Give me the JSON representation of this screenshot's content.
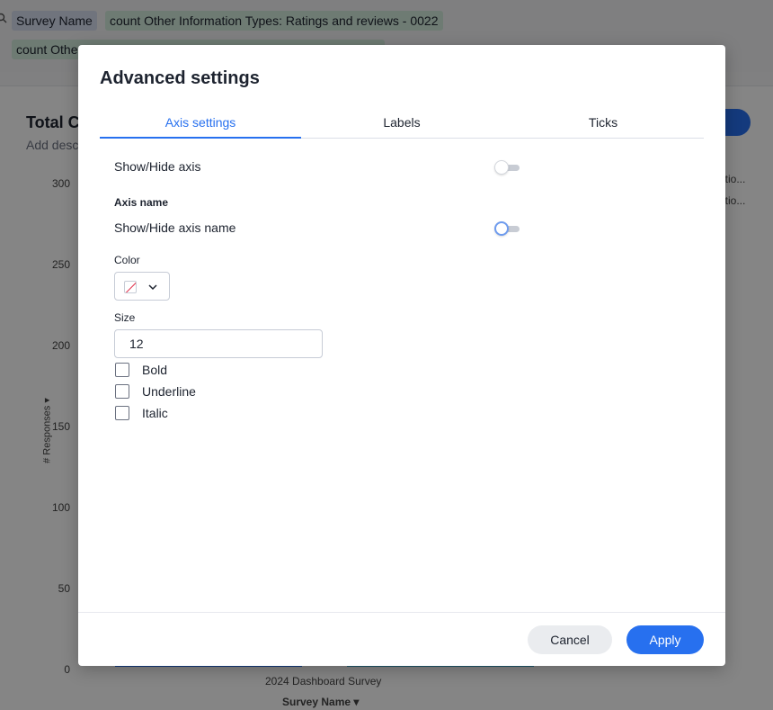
{
  "background": {
    "search_chips": [
      {
        "label": "Survey Name",
        "kind": "attribute"
      },
      {
        "label": "count Other Information Types: Ratings and reviews - 0022",
        "kind": "measure"
      },
      {
        "label": "count Othe",
        "kind": "measure"
      }
    ],
    "card": {
      "title": "Total C",
      "description": "Add desc",
      "legend": [
        "atio...",
        "atio..."
      ]
    },
    "chart_data": {
      "type": "bar",
      "categories": [
        "2024 Dashboard Survey"
      ],
      "ylabel": "# Responses",
      "xlabel": "Survey Name",
      "yticks": [
        "300",
        "250",
        "200",
        "150",
        "100",
        "50",
        "0"
      ],
      "ylim": [
        0,
        300
      ]
    }
  },
  "modal": {
    "title": "Advanced settings",
    "tabs": [
      {
        "label": "Axis settings",
        "active": true
      },
      {
        "label": "Labels",
        "active": false
      },
      {
        "label": "Ticks",
        "active": false
      }
    ],
    "show_hide_axis": {
      "label": "Show/Hide axis",
      "on": false
    },
    "axis_name_section": "Axis name",
    "show_hide_axis_name": {
      "label": "Show/Hide axis name",
      "on": false
    },
    "color_label": "Color",
    "size_label": "Size",
    "size_value": "12",
    "checkboxes": [
      {
        "label": "Bold",
        "checked": false
      },
      {
        "label": "Underline",
        "checked": false
      },
      {
        "label": "Italic",
        "checked": false
      }
    ],
    "cancel_label": "Cancel",
    "apply_label": "Apply",
    "accent_color": "#2770ef"
  }
}
